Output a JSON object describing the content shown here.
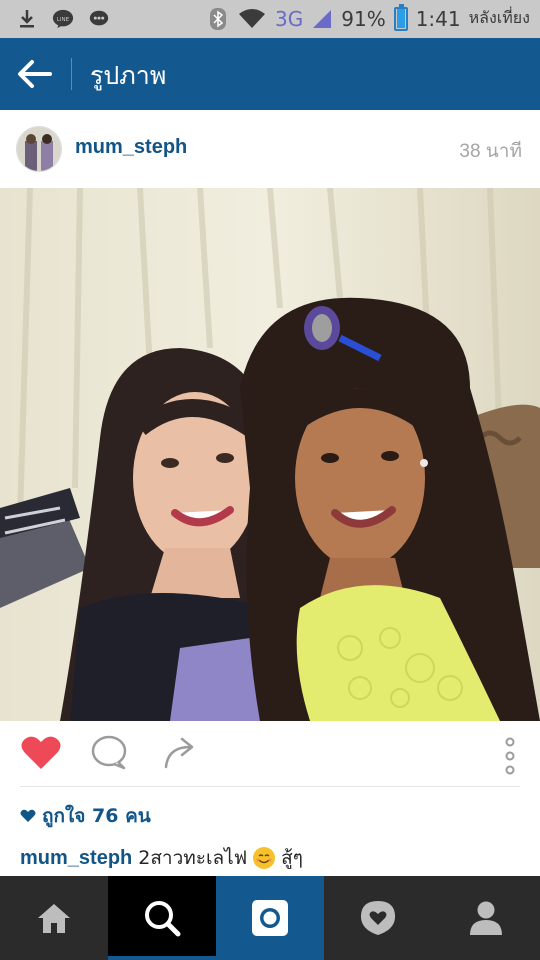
{
  "status_bar": {
    "icons": [
      "download-icon",
      "line-icon",
      "chat-icon",
      "bluetooth-icon",
      "wifi-icon"
    ],
    "network": "3G",
    "battery": "91%",
    "battery_level": 0.91,
    "time": "1:41",
    "ampm": "หลังเที่ยง"
  },
  "header": {
    "title": "รูปภาพ"
  },
  "post": {
    "username": "mum_steph",
    "timestamp": "38 นาที",
    "likes_text": "ถูกใจ 76 คน",
    "liked": true,
    "caption_user": "mum_steph",
    "caption_text": "2สาวทะเลไฟ",
    "caption_emoji": "smiling-face-emoji",
    "caption_suffix": "สู้ๆ"
  },
  "colors": {
    "header_bg": "#13598f",
    "username": "#125688",
    "like_red": "#ed4956",
    "nav_bg": "#2b2b2b"
  },
  "nav": {
    "items": [
      "home-icon",
      "search-icon",
      "camera-icon",
      "activity-icon",
      "profile-icon"
    ],
    "active": "search-icon"
  }
}
